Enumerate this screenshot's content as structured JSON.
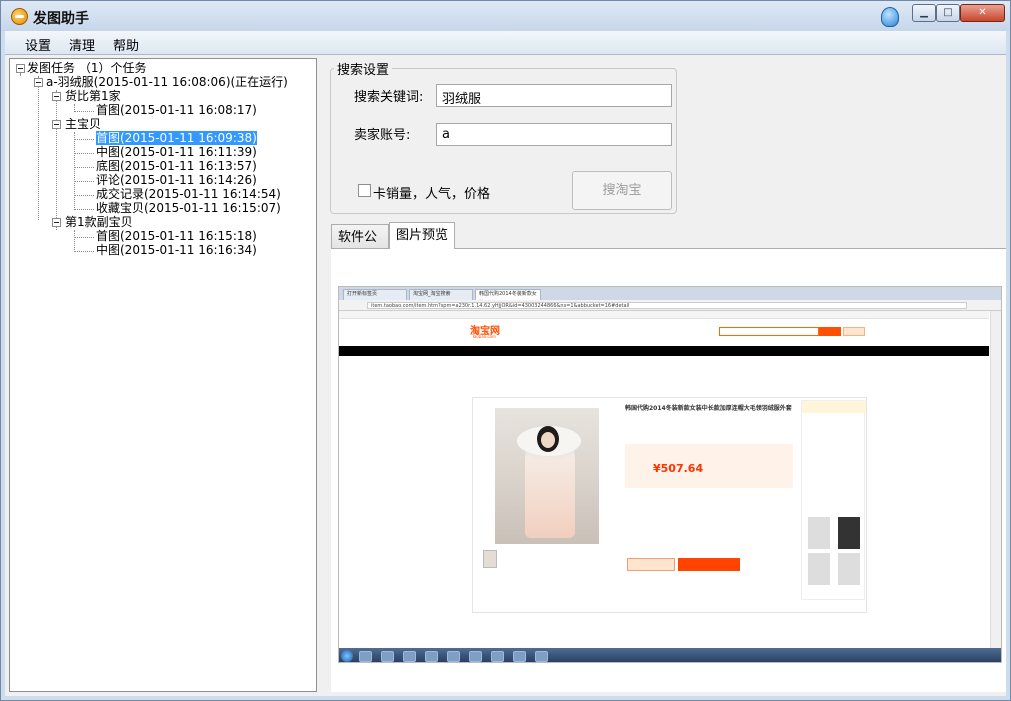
{
  "window": {
    "title": "发图助手",
    "minimize": "▁",
    "maximize": "□",
    "close": "✕"
  },
  "menu": [
    "设置",
    "清理",
    "帮助"
  ],
  "tree": {
    "root": "发图任务 （1）个任务",
    "task": "a-羽绒服(2015-01-11 16:08:06)(正在运行)",
    "groups": [
      {
        "label": "货比第1家",
        "items": [
          "首图(2015-01-11 16:08:17)"
        ]
      },
      {
        "label": "主宝贝",
        "items": [
          "首图(2015-01-11 16:09:38)",
          "中图(2015-01-11 16:11:39)",
          "底图(2015-01-11 16:13:57)",
          "评论(2015-01-11 16:14:26)",
          "成交记录(2015-01-11 16:14:54)",
          "收藏宝贝(2015-01-11 16:15:07)"
        ]
      },
      {
        "label": "第1款副宝贝",
        "items": [
          "首图(2015-01-11 16:15:18)",
          "中图(2015-01-11 16:16:34)"
        ]
      }
    ]
  },
  "search_settings": {
    "title": "搜索设置",
    "keyword_label": "搜索关键词:",
    "keyword_value": "羽绒服",
    "seller_label": "卖家账号:",
    "seller_value": "a",
    "checkbox_label": "卡销量，人气，价格",
    "checkbox_checked": false,
    "search_button": "搜淘宝"
  },
  "tabs": [
    "软件公告",
    "图片预览"
  ],
  "active_tab": "图片预览",
  "preview": {
    "browser_tabs": [
      "打开新标签页",
      "淘宝网_淘宝搜索",
      "韩国代购2014冬装新款女装..."
    ],
    "url": "item.taobao.com/item.htm?spm=a230r.1.14.62.yHjjOR&id=43003244866&ns=1&abbucket=16#detail",
    "logo": "淘宝网",
    "logo_sub": "Taobao.com",
    "product_title": "韩国代购2014冬装新款女装中长款加厚连帽大毛领羽绒服外套",
    "price": "¥507.64"
  }
}
